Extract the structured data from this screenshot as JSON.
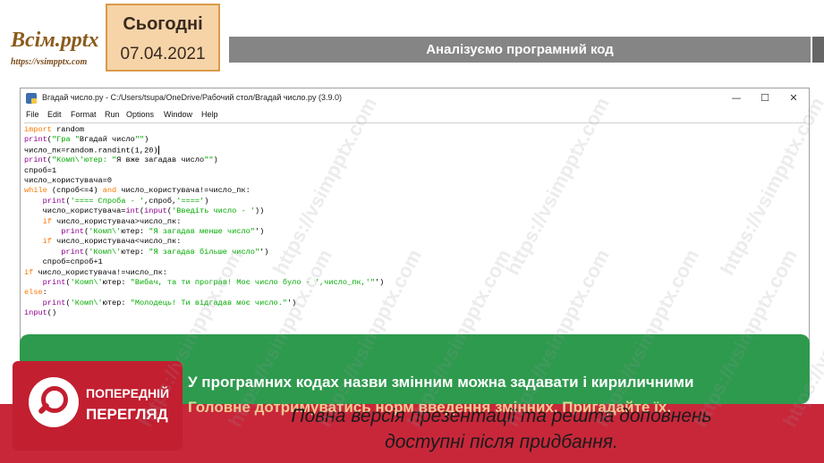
{
  "logo": {
    "title": "Всім.pptx",
    "url": "https://vsimpptx.com"
  },
  "date": {
    "label": "Сьогодні",
    "value": "07.04.2021"
  },
  "slide_title": "Аналізуємо програмний код",
  "ide": {
    "window_title": "Вгадай число.py - C:/Users/tsupa/OneDrive/Рабочий стол/Вгадай число.py (3.9.0)",
    "menu": [
      "File",
      "Edit",
      "Format",
      "Run",
      "Options",
      "Window",
      "Help"
    ],
    "window_buttons": {
      "minimize": "—",
      "maximize": "☐",
      "close": "✕"
    }
  },
  "code_lines": [
    "import random",
    "print(\"Гра \"Вгадай число\"\")",
    "число_пк=random.randint(1,20)",
    "print(\"Комп\\'ютер: \"Я вже загадав число\"\")",
    "спроб=1",
    "число_користувача=0",
    "while (спроб<=4) and число_користувача!=число_пк:",
    "    print('==== Спроба - ',спроб,'====')",
    "    число_користувача=int(input('Введіть число - '))",
    "    if число_користувача>число_пк:",
    "        print('Комп\\'ютер: \"Я загадав менше число\"')",
    "    if число_користувача<число_пк:",
    "        print('Комп\\'ютер: \"Я загадав більше число\"')",
    "    спроб=спроб+1",
    "if число_користувача!=число_пк:",
    "    print('Комп\\'ютер: \"Вибач, та ти програв! Моє число було - ',число_пк,'\"')",
    "else:",
    "    print('Комп\\'ютер: \"Молодець! Ти відгадав моє число.\"')",
    "input()"
  ],
  "info": {
    "line1": "У програмних кодах назви змінним можна задавати і кириличними",
    "line2": "Головне дотримуватись норм введення змінних. Пригадайте їх."
  },
  "preview": {
    "label1": "ПОПЕРЕДНІЙ",
    "label2": "ПЕРЕГЛЯД"
  },
  "bottom_message": {
    "line1": "Повна версія презентації та решта доповнень",
    "line2": "доступні після придбання."
  },
  "watermark_text": "https://vsimpptx.com",
  "colors": {
    "title_bar": "#858585",
    "date_box": "#f6d4a8",
    "green": "#2e9a4e",
    "red": "#c8273a"
  }
}
